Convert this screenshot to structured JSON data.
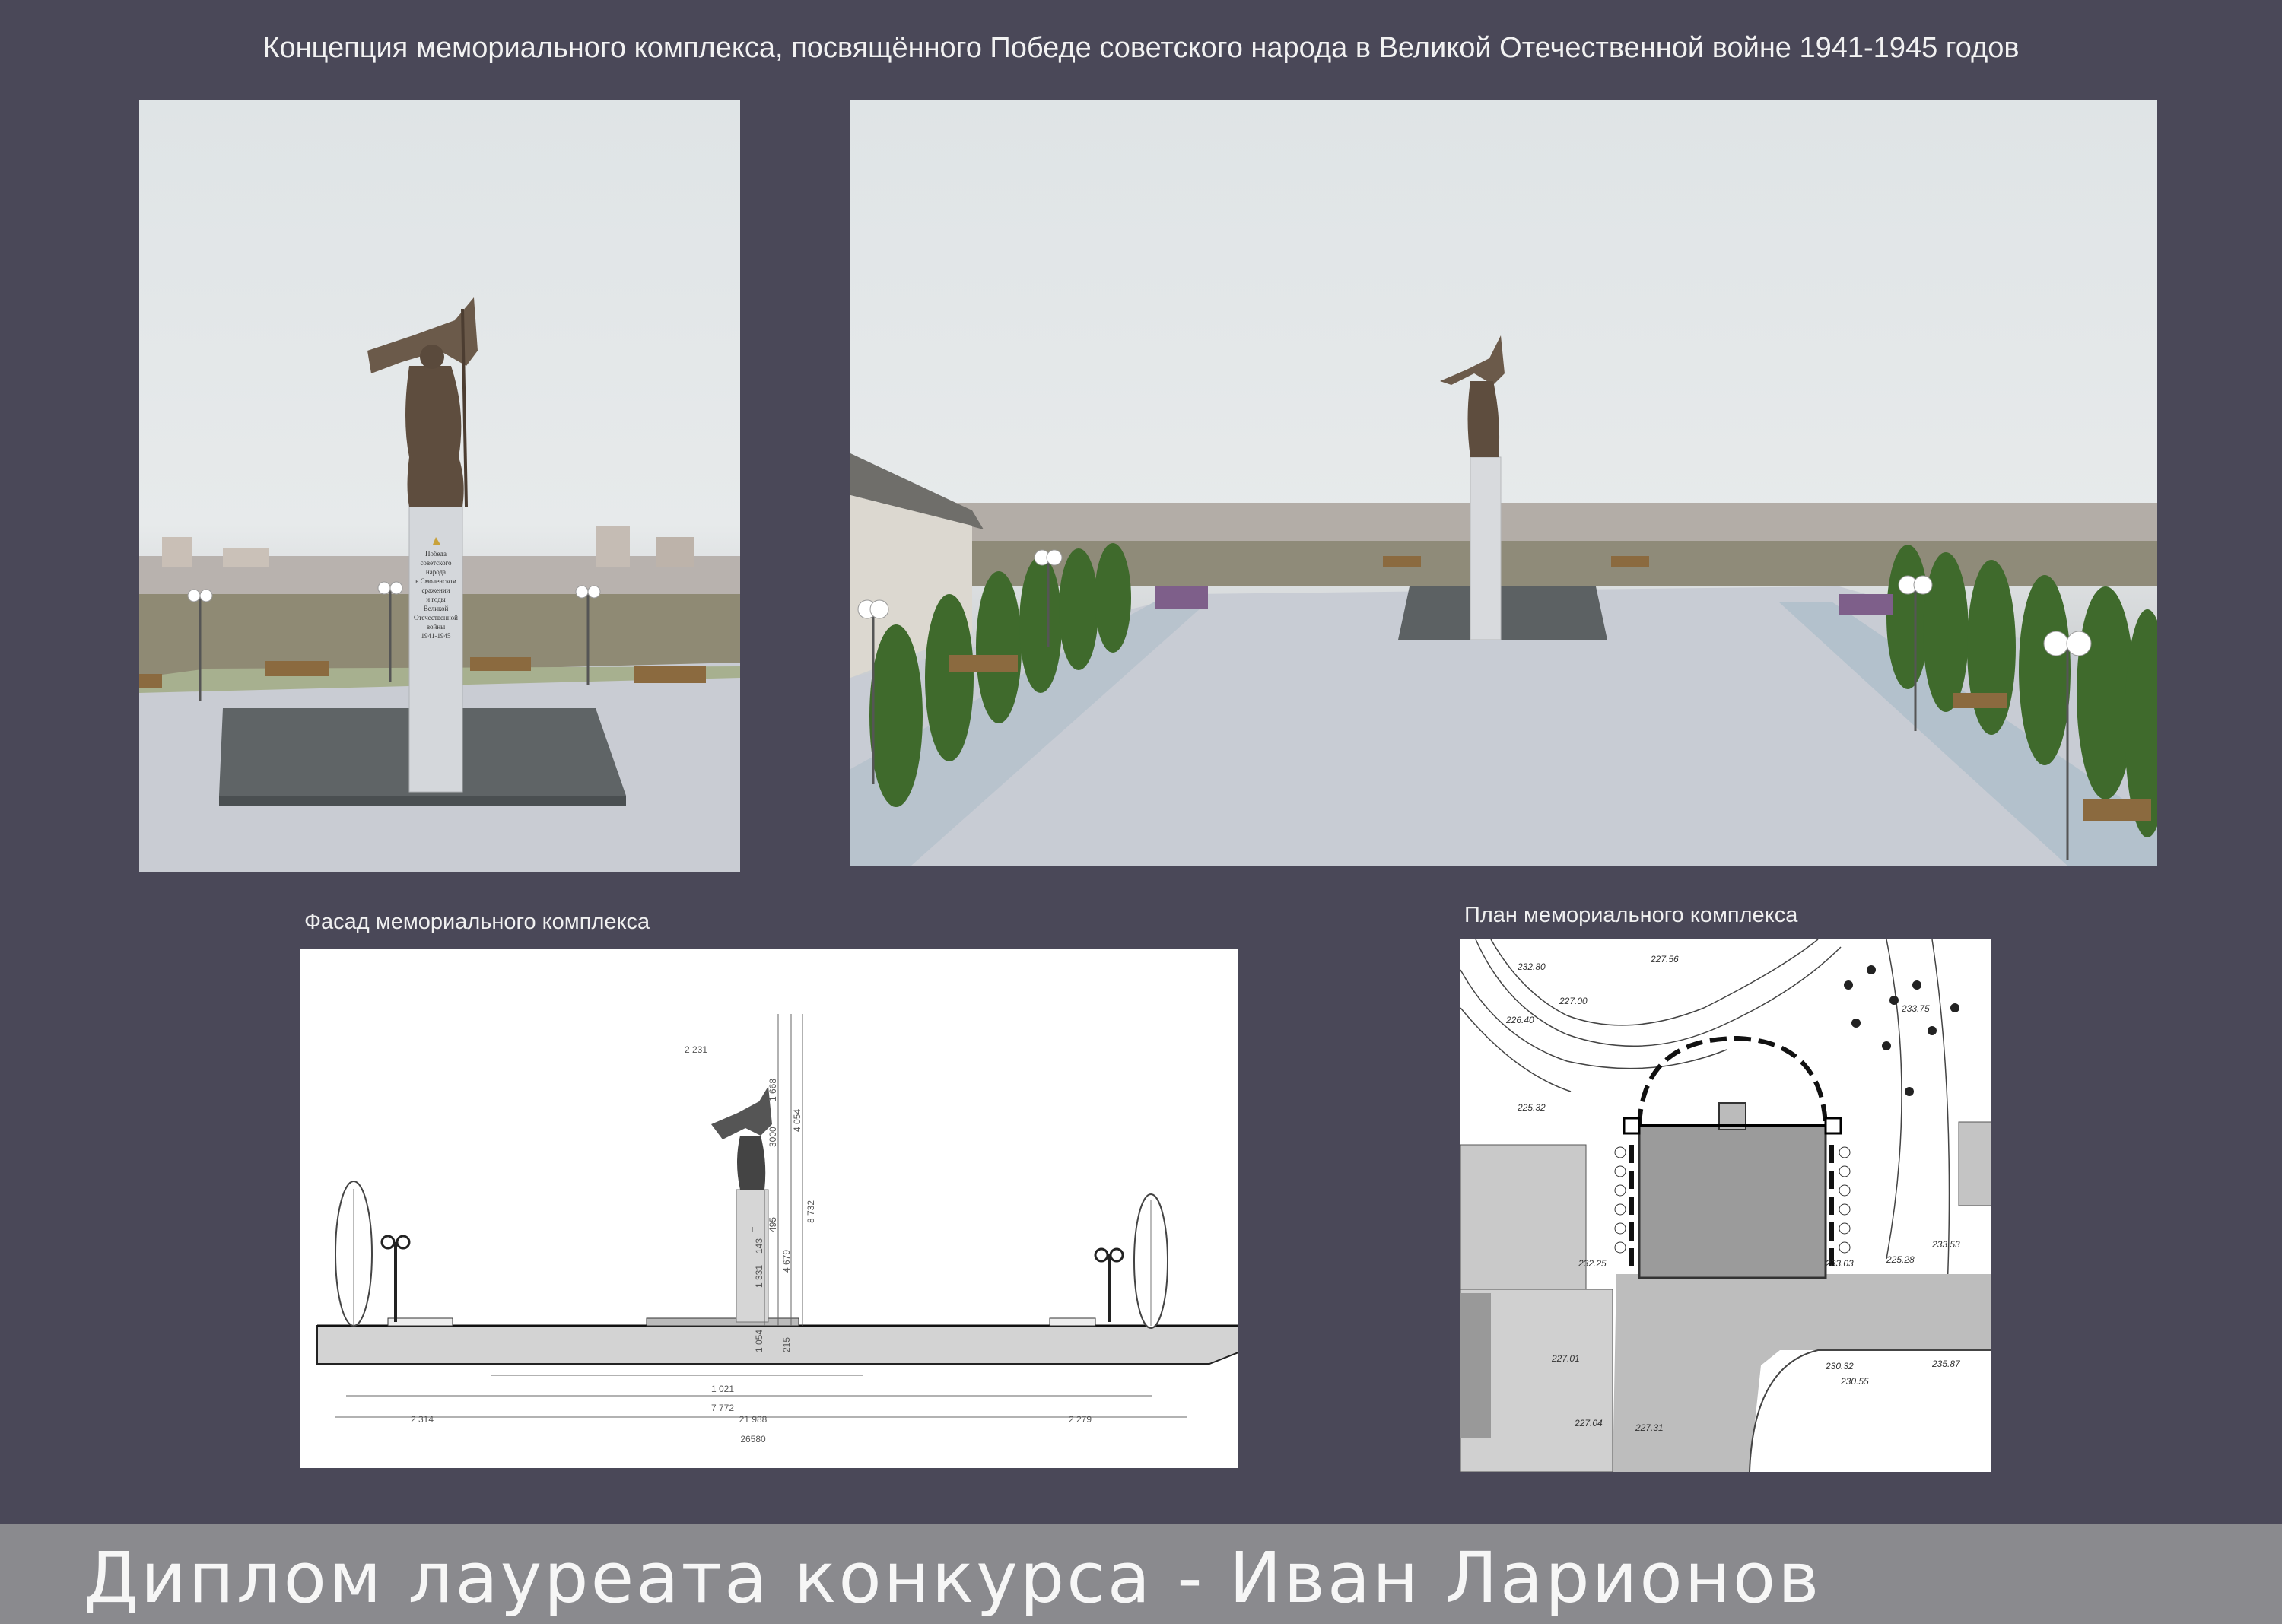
{
  "header": {
    "title": "Концепция мемориального комплекса, посвящённого Победе советского народа в Великой Отечественной войне 1941-1945 годов"
  },
  "render_left": {
    "plaque_lines": [
      "Победа",
      "советского",
      "народа",
      "в Смоленском",
      "сражении",
      "и годы",
      "Великой",
      "Отечественной",
      "войны",
      "1941-1945"
    ]
  },
  "facade": {
    "caption": "Фасад мемориального комплекса",
    "dims": {
      "top": "2 231",
      "h1": "1 668",
      "h2": "3000",
      "h3": "4 054",
      "h4": "495",
      "h5": "143",
      "h6": "8 732",
      "h7": "1 331",
      "h8": "4 679",
      "h9": "1 054",
      "h10": "215",
      "w1": "1 021",
      "w2": "7 772",
      "w3": "2 314",
      "w4": "21 988",
      "w5": "2 279",
      "w6": "26580"
    }
  },
  "plan": {
    "caption": "План мемориального комплекса",
    "elevations": [
      "232.80",
      "227.56",
      "227.00",
      "226.40",
      "225.32",
      "233.75",
      "233.53",
      "225.28",
      "227.01",
      "232.25",
      "233.03",
      "230.32",
      "230.55",
      "235.87",
      "227.04",
      "227.31"
    ]
  },
  "footer": {
    "text": "Диплом лауреата конкурса - Иван Ларионов"
  },
  "colors": {
    "background": "#4a4858",
    "footer_band": "#8a8a8e",
    "granite": "#5f6466",
    "bronze": "#6b5a4a",
    "cypress": "#3f6a2c"
  }
}
